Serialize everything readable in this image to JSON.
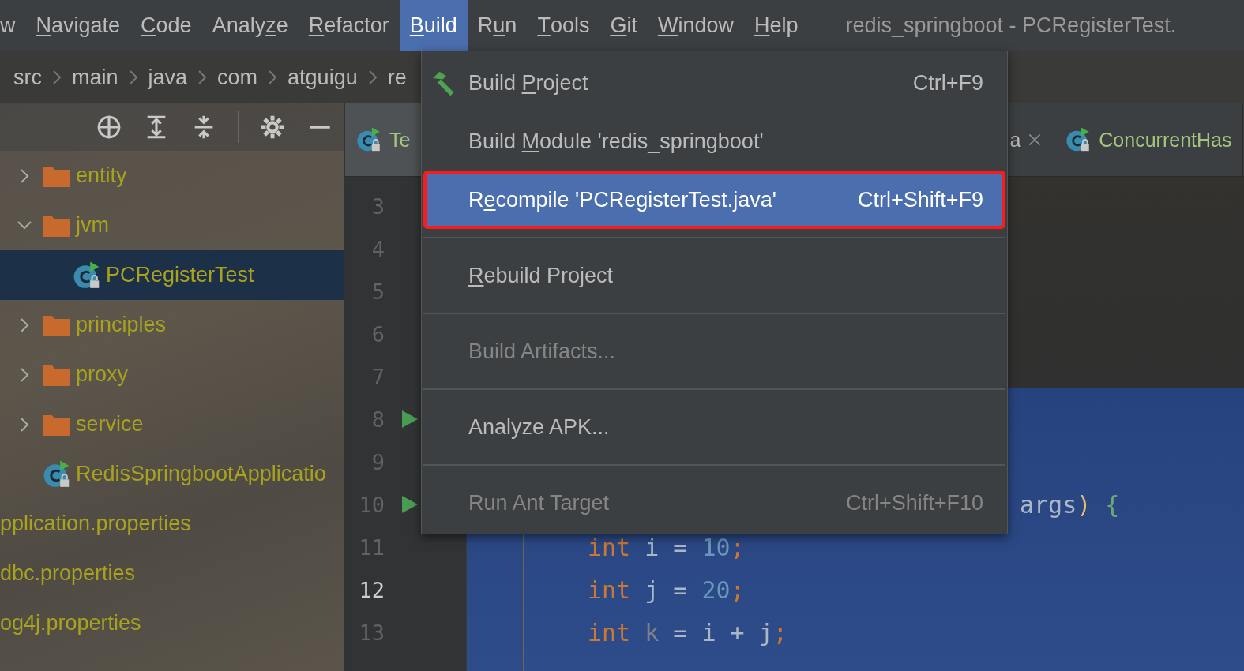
{
  "menu_bar": {
    "items": [
      {
        "pre": "w",
        "selected": false
      },
      {
        "key": "N",
        "post": "avigate",
        "selected": false
      },
      {
        "key": "C",
        "post": "ode",
        "selected": false
      },
      {
        "pre": "Analy",
        "key": "z",
        "post": "e",
        "selected": false
      },
      {
        "key": "R",
        "post": "efactor",
        "selected": false
      },
      {
        "key": "B",
        "post": "uild",
        "selected": true
      },
      {
        "pre": "R",
        "key": "u",
        "post": "n",
        "selected": false
      },
      {
        "key": "T",
        "post": "ools",
        "selected": false
      },
      {
        "key": "G",
        "post": "it",
        "selected": false
      },
      {
        "key": "W",
        "post": "indow",
        "selected": false
      },
      {
        "key": "H",
        "post": "elp",
        "selected": false
      }
    ],
    "window_title": "redis_springboot - PCRegisterTest."
  },
  "breadcrumbs": [
    "src",
    "main",
    "java",
    "com",
    "atguigu",
    "re"
  ],
  "project_tree": [
    {
      "kind": "folder",
      "label": "entity",
      "expanded": false,
      "selected": false
    },
    {
      "kind": "folder",
      "label": "jvm",
      "expanded": true,
      "selected": false,
      "children": [
        {
          "kind": "class",
          "label": "PCRegisterTest",
          "selected": true
        }
      ]
    },
    {
      "kind": "folder",
      "label": "principles",
      "expanded": false,
      "selected": false
    },
    {
      "kind": "folder",
      "label": "proxy",
      "expanded": false,
      "selected": false
    },
    {
      "kind": "folder",
      "label": "service",
      "expanded": false,
      "selected": false
    },
    {
      "kind": "class",
      "label": "RedisSpringbootApplicatio",
      "selected": false
    },
    {
      "kind": "file",
      "label": "pplication.properties",
      "selected": false
    },
    {
      "kind": "file",
      "label": "dbc.properties",
      "selected": false
    },
    {
      "kind": "file",
      "label": "og4j.properties",
      "selected": false
    }
  ],
  "editor": {
    "tabs": [
      {
        "label": "Te",
        "icon": true,
        "closable": false,
        "selected": true
      },
      {
        "label": "a",
        "icon": false,
        "closable": true,
        "selected": false
      },
      {
        "label": "ConcurrentHas",
        "icon": true,
        "closable": false,
        "selected": false
      }
    ],
    "gutter": [
      {
        "number": "3",
        "run": false,
        "current": false
      },
      {
        "number": "4",
        "run": false,
        "current": false
      },
      {
        "number": "5",
        "run": false,
        "current": false
      },
      {
        "number": "6",
        "run": false,
        "current": false
      },
      {
        "number": "7",
        "run": false,
        "current": false
      },
      {
        "number": "8",
        "run": true,
        "current": false
      },
      {
        "number": "9",
        "run": false,
        "current": false
      },
      {
        "number": "10",
        "run": true,
        "current": false
      },
      {
        "number": "11",
        "run": false,
        "current": false
      },
      {
        "number": "12",
        "run": false,
        "current": true
      },
      {
        "number": "13",
        "run": false,
        "current": false
      }
    ],
    "code_lines": [
      {
        "kind": "tail",
        "tokens": [
          {
            "kind": "ident",
            "text": "args"
          },
          {
            "kind": "paren",
            "text": ")"
          },
          {
            "kind": "brace",
            "text": " {"
          }
        ]
      },
      {
        "kind": "body",
        "tokens": [
          {
            "kind": "keyword",
            "text": "int"
          },
          {
            "kind": "ident",
            "text": " i = "
          },
          {
            "kind": "number",
            "text": "10"
          },
          {
            "kind": "punct",
            "text": ";"
          }
        ]
      },
      {
        "kind": "body",
        "tokens": [
          {
            "kind": "keyword",
            "text": "int"
          },
          {
            "kind": "ident",
            "text": " j = "
          },
          {
            "kind": "number",
            "text": "20"
          },
          {
            "kind": "punct",
            "text": ";"
          }
        ]
      },
      {
        "kind": "body",
        "tokens": [
          {
            "kind": "keyword",
            "text": "int"
          },
          {
            "kind": "unused",
            "text": " k"
          },
          {
            "kind": "ident",
            "text": " = i + j"
          },
          {
            "kind": "punct",
            "text": ";"
          }
        ]
      }
    ]
  },
  "build_menu": {
    "items": [
      {
        "kind": "item",
        "pre": "Build ",
        "key": "P",
        "post": "roject",
        "shortcut": "Ctrl+F9",
        "icon": true,
        "disabled": false,
        "selected": false,
        "highlighted": false
      },
      {
        "kind": "item",
        "pre": "Build ",
        "key": "M",
        "post": "odule 'redis_springboot'",
        "icon": false,
        "disabled": false,
        "selected": false,
        "highlighted": false
      },
      {
        "kind": "item",
        "pre": "R",
        "key": "e",
        "post": "compile 'PCRegisterTest.java'",
        "shortcut": "Ctrl+Shift+F9",
        "icon": false,
        "disabled": false,
        "selected": true,
        "highlighted": true
      },
      {
        "kind": "separator"
      },
      {
        "kind": "item",
        "key": "R",
        "post": "ebuild Project",
        "icon": false,
        "disabled": false,
        "selected": false,
        "highlighted": false
      },
      {
        "kind": "separator"
      },
      {
        "kind": "item",
        "pre": "Build Artifacts...",
        "icon": false,
        "disabled": true,
        "selected": false,
        "highlighted": false
      },
      {
        "kind": "separator"
      },
      {
        "kind": "item",
        "pre": "Analyze APK...",
        "icon": false,
        "disabled": false,
        "selected": false,
        "highlighted": false
      },
      {
        "kind": "separator"
      },
      {
        "kind": "item",
        "pre": "Run Ant Target",
        "shortcut": "Ctrl+Shift+F10",
        "icon": false,
        "disabled": true,
        "selected": false,
        "highlighted": false
      }
    ]
  }
}
